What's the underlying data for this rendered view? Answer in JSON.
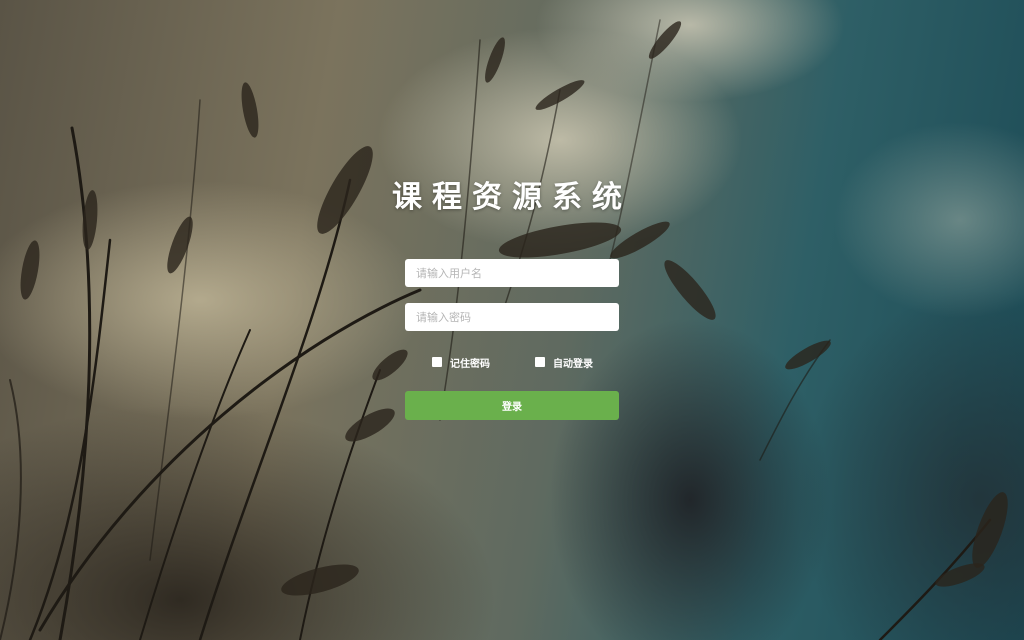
{
  "title": "课程资源系统",
  "form": {
    "username_placeholder": "请输入用户名",
    "password_placeholder": "请输入密码",
    "remember_label": "记住密码",
    "auto_login_label": "自动登录",
    "remember_checked": false,
    "auto_login_checked": false,
    "login_label": "登录"
  },
  "colors": {
    "login_button": "#6ab04c",
    "title_text": "#ffffff",
    "input_background": "#ffffff"
  }
}
